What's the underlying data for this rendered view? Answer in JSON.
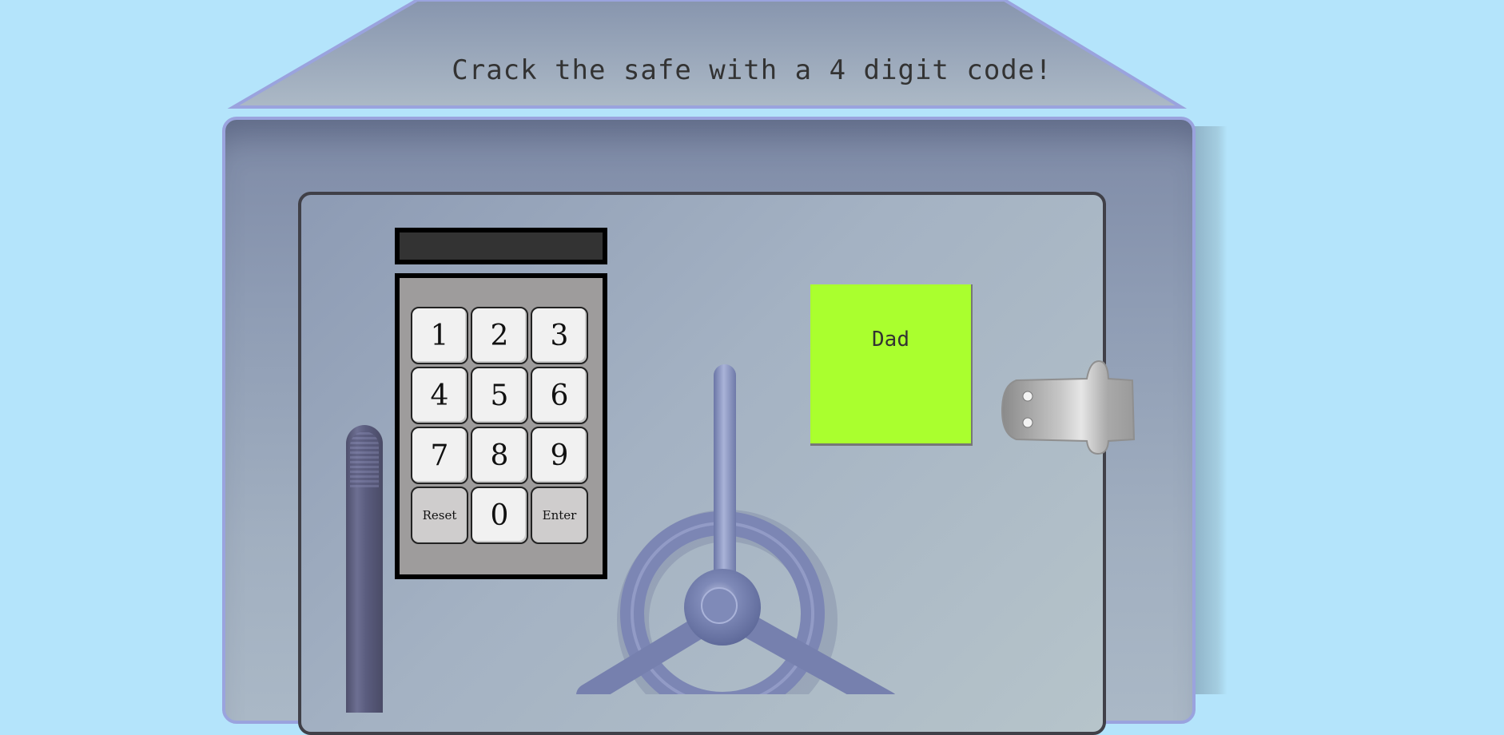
{
  "title": "Crack the safe with a 4 digit code!",
  "display": {
    "value": ""
  },
  "keypad": {
    "keys": [
      "1",
      "2",
      "3",
      "4",
      "5",
      "6",
      "7",
      "8",
      "9",
      "Reset",
      "0",
      "Enter"
    ]
  },
  "sticky_note": {
    "text": "Dad"
  },
  "colors": {
    "background": "#b4e4fb",
    "note": "#aaff2e",
    "display": "#333333",
    "keypad": "#9e9c9c",
    "wheel": "#7c86b4"
  }
}
